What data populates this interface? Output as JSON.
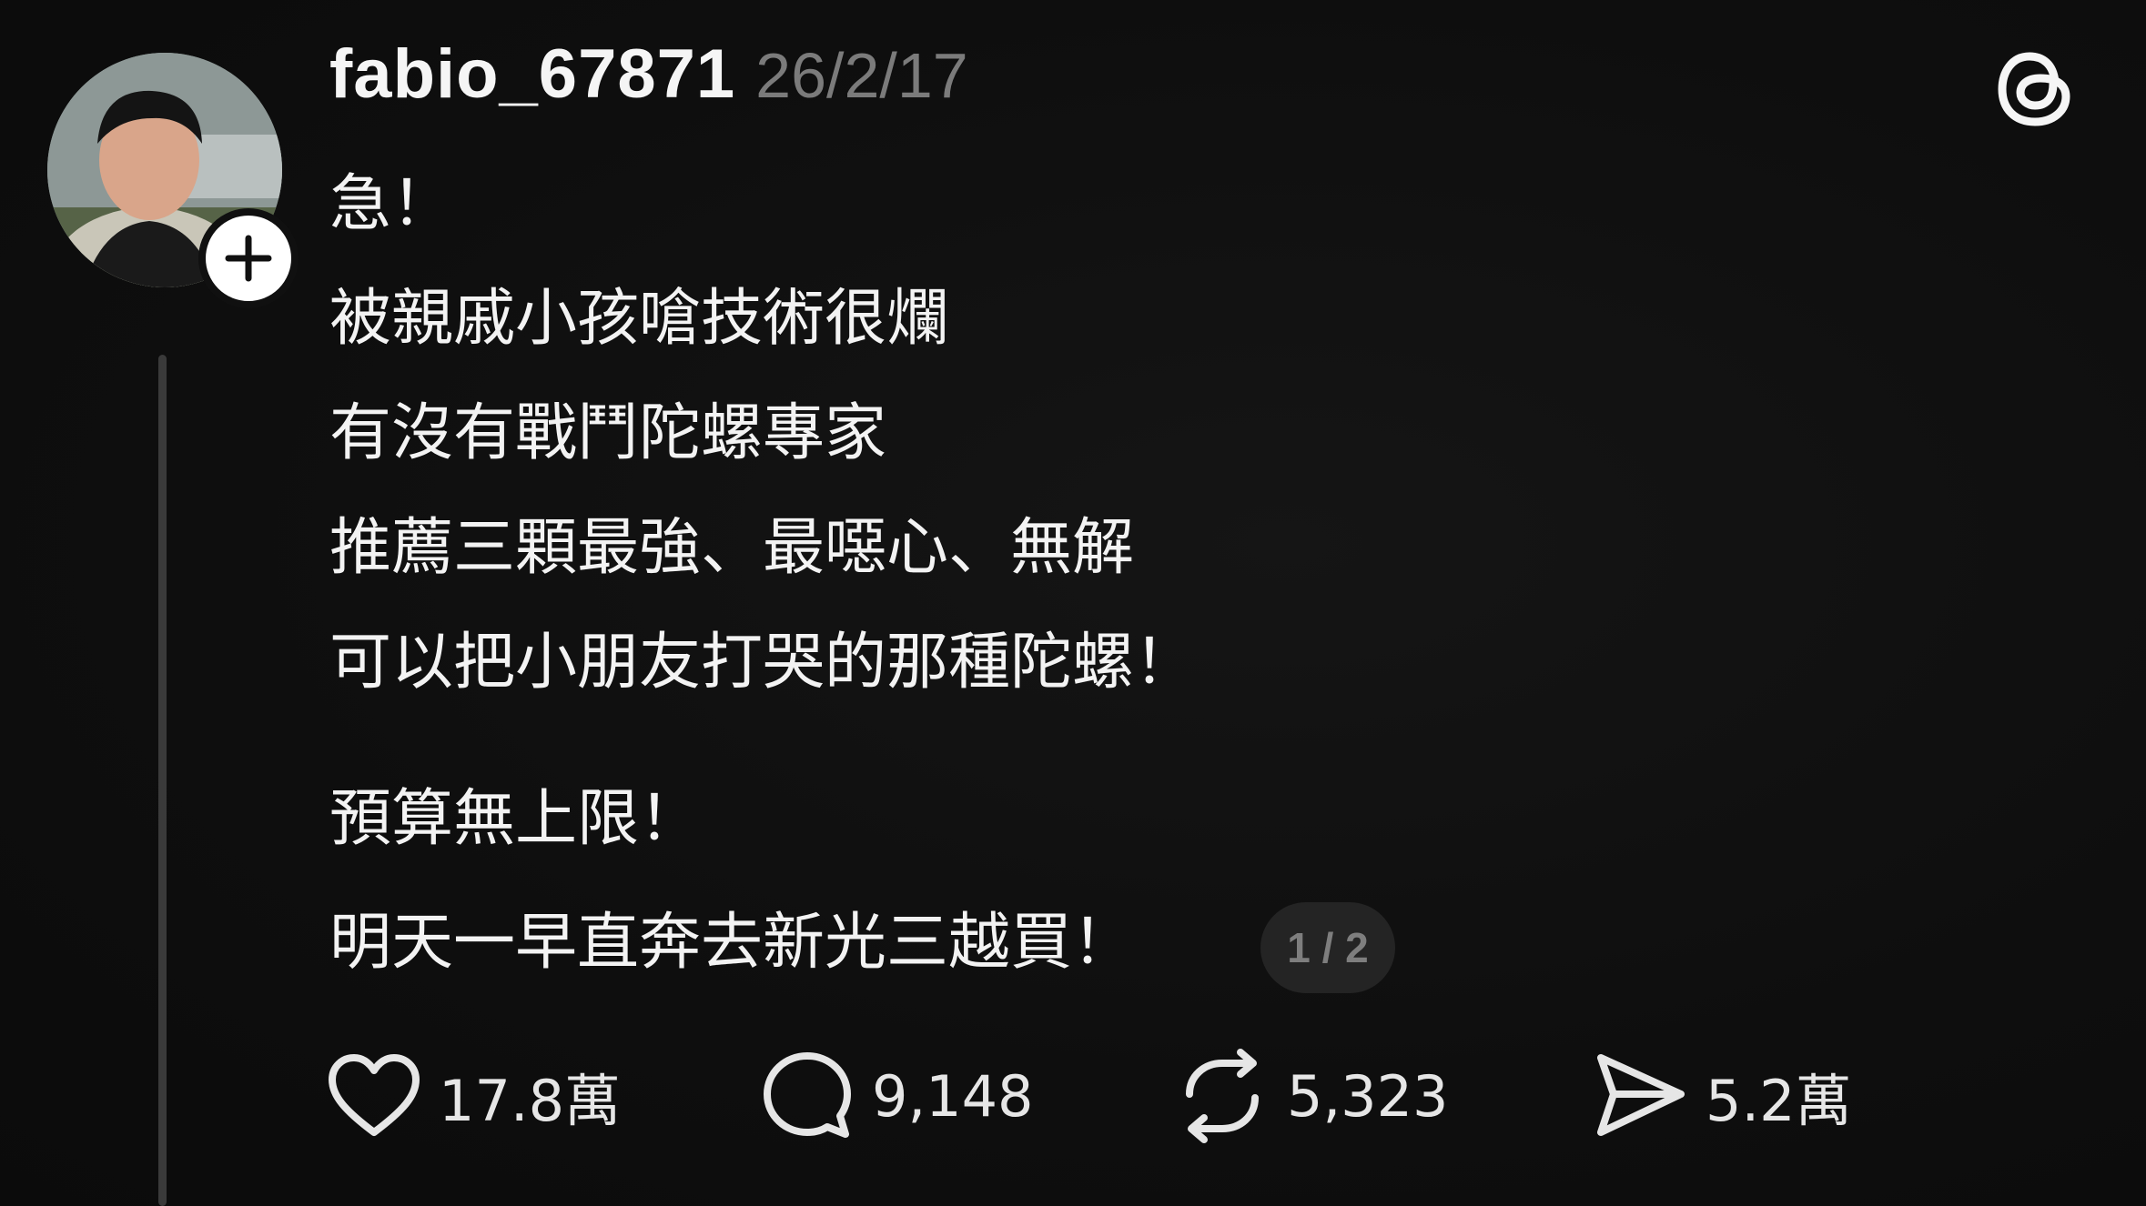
{
  "post": {
    "username": "fabio_67871",
    "timestamp": "26/2/17",
    "body_lines": [
      "急！",
      "被親戚小孩嗆技術很爛",
      "有沒有戰鬥陀螺專家",
      "推薦三顆最強、最噁心、無解",
      "可以把小朋友打哭的那種陀螺！",
      "預算無上限！",
      "明天一早直奔去新光三越買！"
    ],
    "page_indicator": "1 / 2"
  },
  "actions": {
    "likes": "17.8萬",
    "replies": "9,148",
    "reposts": "5,323",
    "shares": "5.2萬"
  },
  "icons": {
    "like": "heart-icon",
    "reply": "comment-icon",
    "repost": "repost-icon",
    "share": "send-icon",
    "logo": "threads-logo-icon",
    "follow": "plus-icon"
  },
  "colors": {
    "background": "#101010",
    "text": "#f3f3f3",
    "muted": "#7b7b7b",
    "thread_line": "#3a3a3a"
  }
}
